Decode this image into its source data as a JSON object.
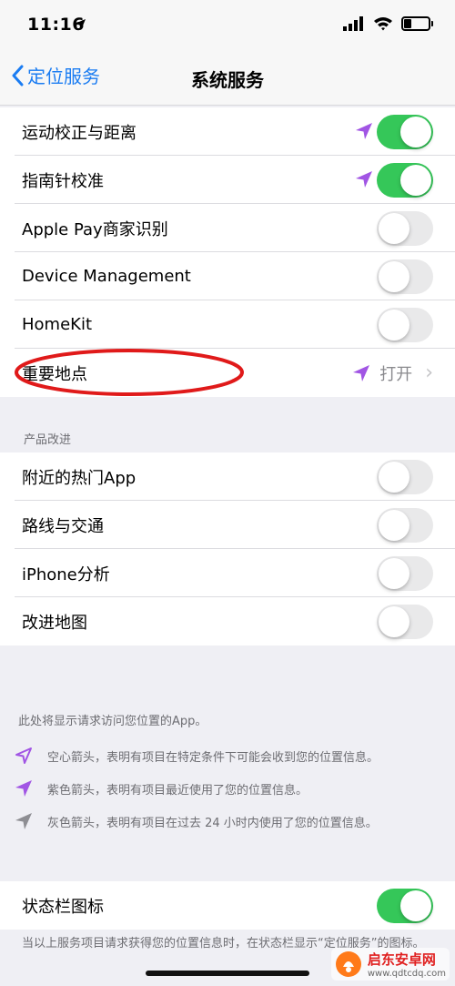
{
  "status_bar": {
    "time": "11:16"
  },
  "nav": {
    "back_label": "定位服务",
    "title": "系统服务"
  },
  "group1": [
    {
      "label": "运动校正与距离",
      "arrow": "purple-arrow-icon",
      "toggle_on": true
    },
    {
      "label": "指南针校准",
      "arrow": "purple-arrow-icon",
      "toggle_on": true
    },
    {
      "label": "Apple Pay商家识别",
      "toggle_on": false
    },
    {
      "label": "Device Management",
      "toggle_on": false
    },
    {
      "label": "HomeKit",
      "toggle_on": false
    },
    {
      "label": "重要地点",
      "arrow": "purple-arrow-icon",
      "value": "打开"
    }
  ],
  "section_header": "产品改进",
  "group2": [
    {
      "label": "附近的热门App",
      "toggle_on": false
    },
    {
      "label": "路线与交通",
      "toggle_on": false
    },
    {
      "label": "iPhone分析",
      "toggle_on": false
    },
    {
      "label": "改进地图",
      "toggle_on": false
    }
  ],
  "footer": {
    "intro": "此处将显示请求访问您位置的App。",
    "legend": [
      {
        "icon": "hollow-arrow-icon",
        "text": "空心箭头，表明有项目在特定条件下可能会收到您的位置信息。"
      },
      {
        "icon": "purple-arrow-icon",
        "text": "紫色箭头，表明有项目最近使用了您的位置信息。"
      },
      {
        "icon": "gray-arrow-icon",
        "text": "灰色箭头，表明有项目在过去 24 小时内使用了您的位置信息。"
      }
    ]
  },
  "status_icon_row": {
    "label": "状态栏图标",
    "toggle_on": true
  },
  "bottom_note": "当以上服务项目请求获得您的位置信息时，在状态栏显示“定位服务”的图标。",
  "watermark": {
    "title": "启东安卓网",
    "url": "www.qdtcdq.com"
  },
  "colors": {
    "accent": "#1a7cf2",
    "toggle_on": "#35c759",
    "purple_arrow": "#a155e4",
    "annotation": "#e01a1a"
  }
}
